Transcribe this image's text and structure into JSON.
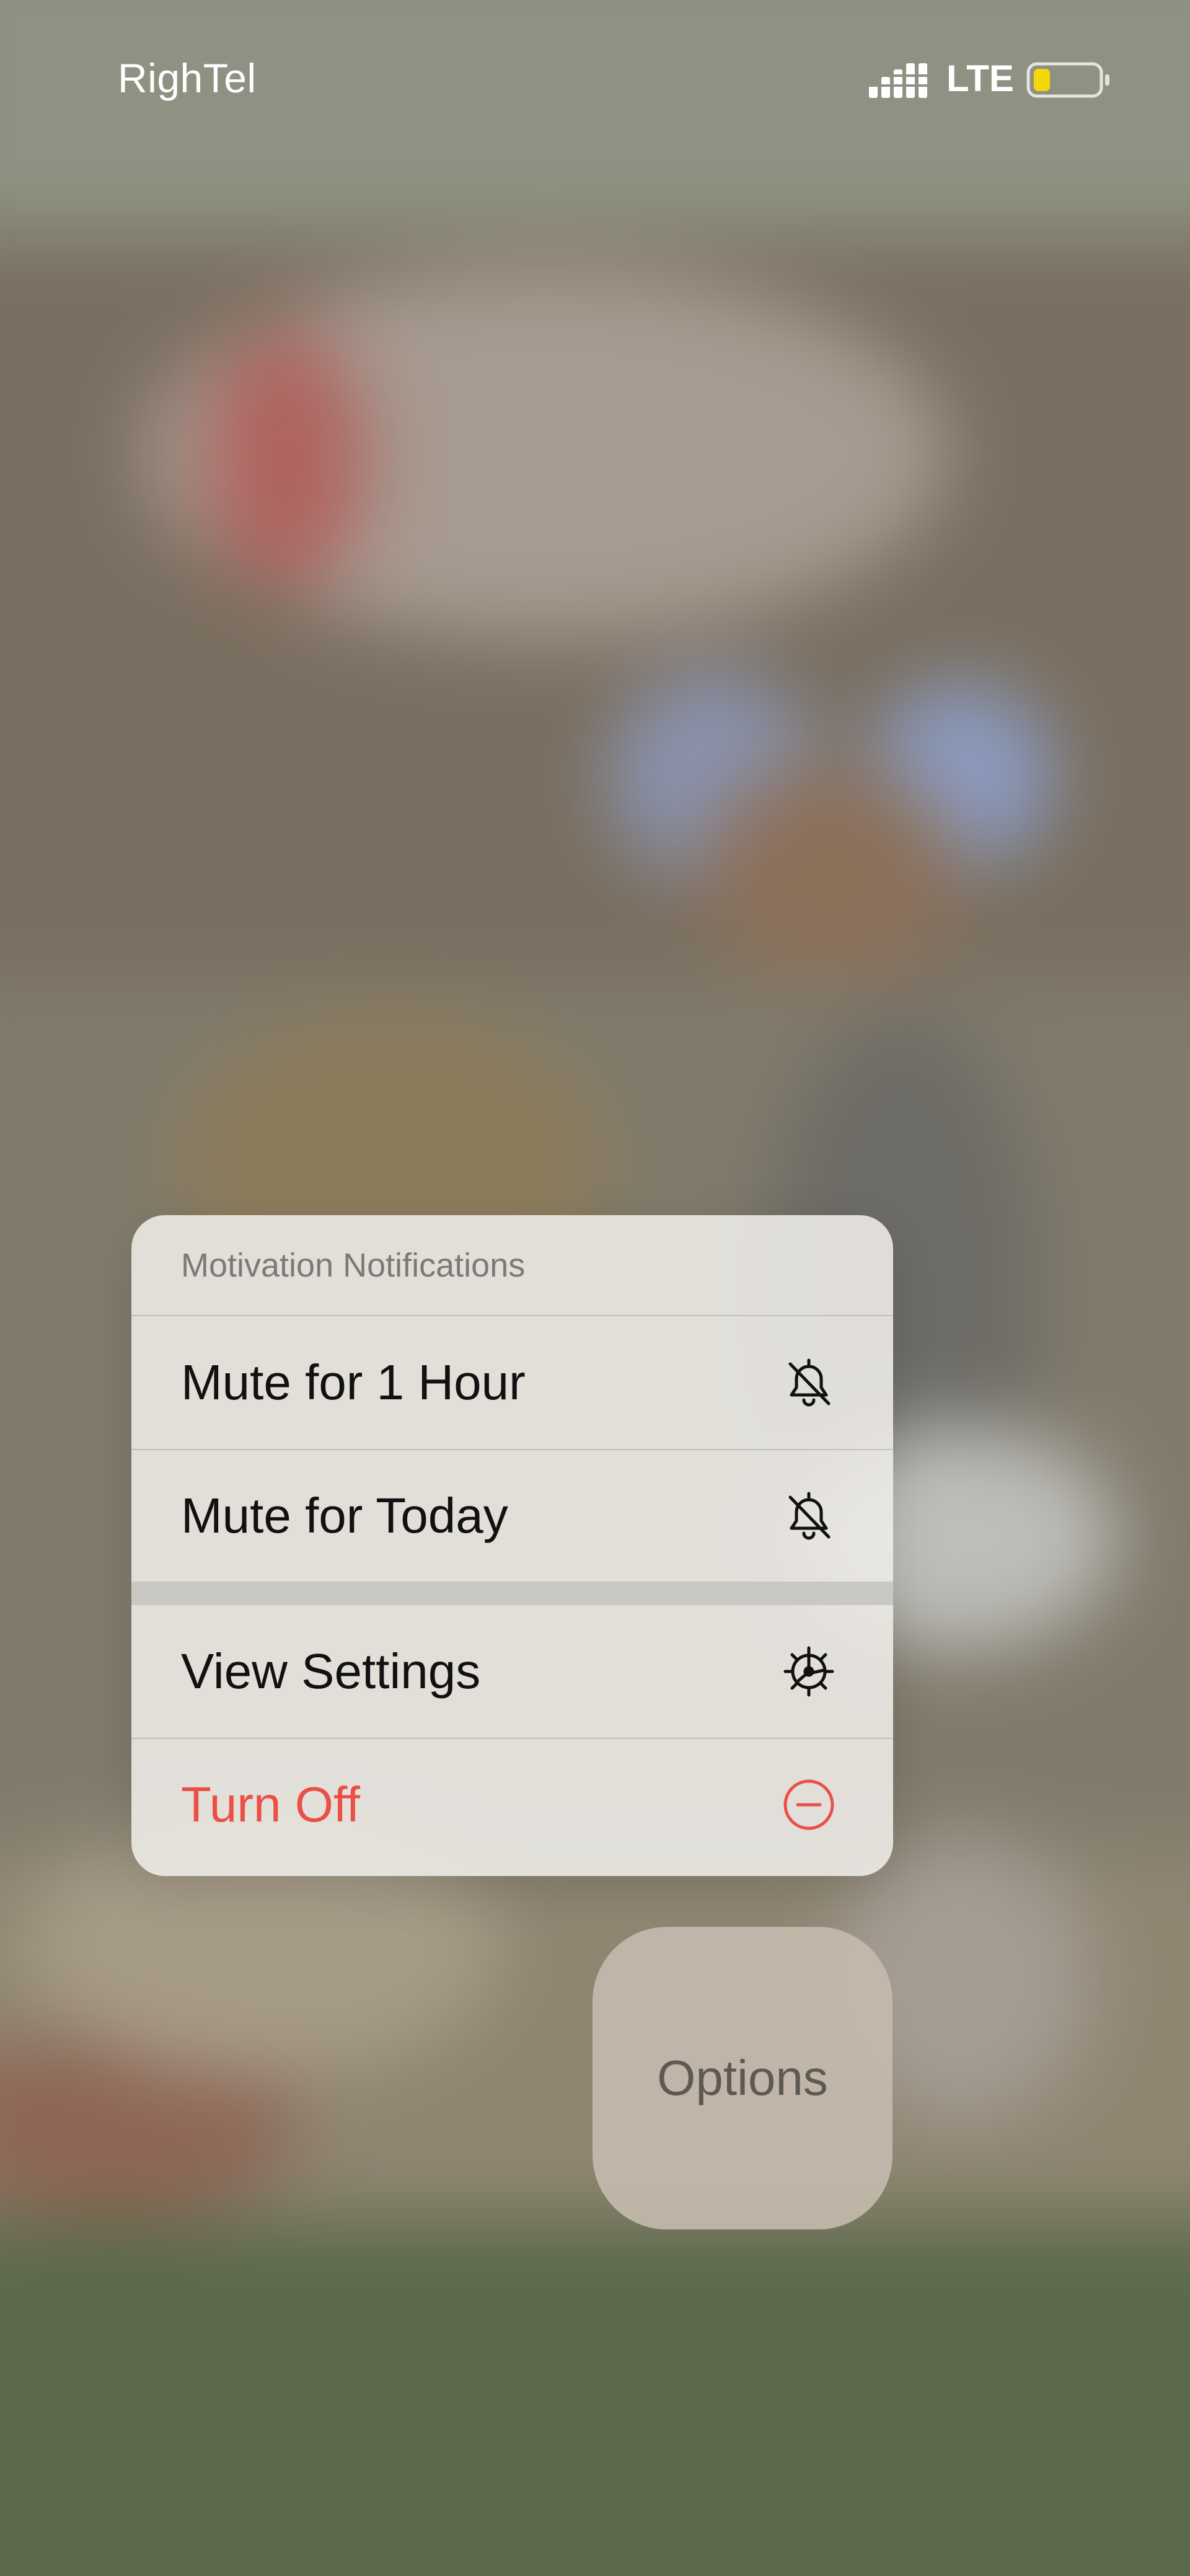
{
  "status_bar": {
    "carrier": "RighTel",
    "network": "LTE",
    "battery_level": 0.25,
    "battery_color": "#f5d60a",
    "signal_icon": "signal-bars-icon",
    "battery_icon": "battery-icon"
  },
  "menu": {
    "title": "Motivation Notifications",
    "items": [
      {
        "label": "Mute for 1 Hour",
        "icon": "bell-slash-icon"
      },
      {
        "label": "Mute for Today",
        "icon": "bell-slash-icon"
      },
      {
        "label": "View Settings",
        "icon": "gear-icon"
      },
      {
        "label": "Turn Off",
        "icon": "minus-circle-icon",
        "color": "#eb4f45"
      }
    ]
  },
  "options": {
    "label": "Options"
  }
}
